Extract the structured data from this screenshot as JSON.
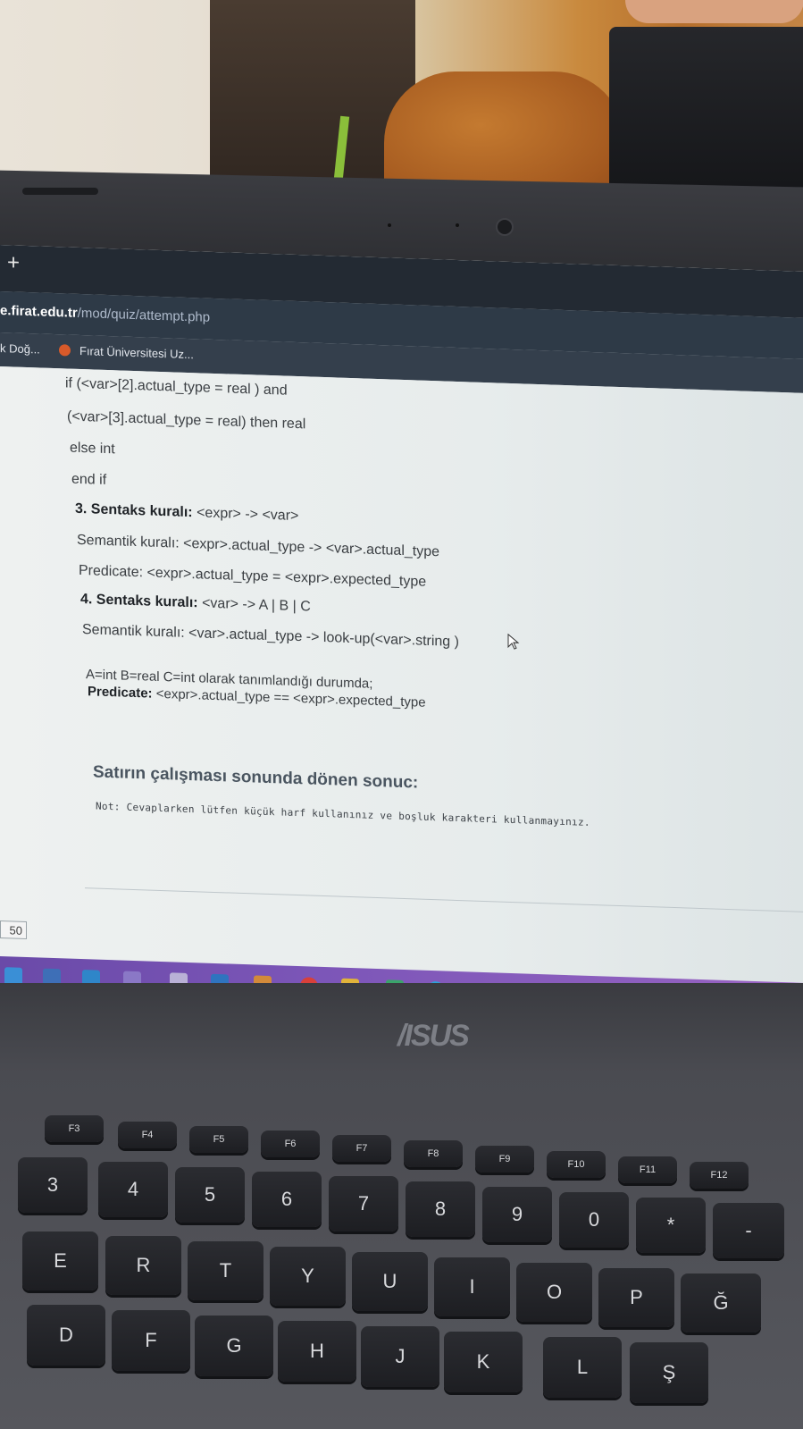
{
  "browser": {
    "new_tab_glyph": "+",
    "url_host": "e.firat.edu.tr",
    "url_path": "/mod/quiz/attempt.php",
    "bookmarks": [
      {
        "label": "k Doğ..."
      },
      {
        "label": "Fırat Üniversitesi Uz..."
      }
    ]
  },
  "quiz": {
    "lines": [
      "if (<var>[2].actual_type = real ) and",
      "(<var>[3].actual_type = real) then real",
      "else int",
      "end if"
    ],
    "rule3_title": "3. Sentaks kuralı:",
    "rule3_syntax": " <expr> -> <var>",
    "rule3_semantic": "Semantik kuralı: <expr>.actual_type -> <var>.actual_type",
    "rule3_predicate": "Predicate: <expr>.actual_type = <expr>.expected_type",
    "rule4_title": "4. Sentaks kuralı:",
    "rule4_syntax": " <var> -> A | B | C",
    "rule4_semantic": "Semantik kuralı: <var>.actual_type -> look-up(<var>.string )",
    "assignment": "A=int B=real C=int olarak tanımlandığı durumda;",
    "predicate_label": "Predicate:",
    "predicate_text": " <expr>.actual_type == <expr>.expected_type",
    "result_heading": "Satırın çalışması sonunda dönen sonuc:",
    "note": "Not: Cevaplarken lütfen küçük harf kullanınız ve boşluk karakteri kullanmayınız.",
    "zoom_fragment": "50"
  },
  "laptop": {
    "brand": "/ISUS"
  },
  "keyboard": {
    "function_row": [
      "F3",
      "F4",
      "F5",
      "F6",
      "F7",
      "F8",
      "F9",
      "F10",
      "F11",
      "F12"
    ],
    "number_row": [
      {
        "main": "3",
        "top": "^",
        "bottom": "#"
      },
      {
        "main": "4",
        "top": "+",
        "bottom": "$"
      },
      {
        "main": "5",
        "top": "%",
        "bottom": "½"
      },
      {
        "main": "6",
        "top": "&",
        "bottom": ""
      },
      {
        "main": "7",
        "top": "/",
        "bottom": "{"
      },
      {
        "main": "8",
        "top": "(",
        "bottom": "["
      },
      {
        "main": "9",
        "top": ")",
        "bottom": "]"
      },
      {
        "main": "0",
        "top": "=",
        "bottom": "}"
      },
      {
        "main": "*",
        "top": "?",
        "bottom": "\\"
      },
      {
        "main": "-",
        "top": "",
        "bottom": ""
      }
    ],
    "letter_row_1": [
      "E",
      "R",
      "T",
      "Y",
      "U",
      "I",
      "O",
      "P",
      "Ğ"
    ],
    "letter_row_1_sub": "€",
    "letter_row_2": [
      "D",
      "F",
      "G",
      "H",
      "J",
      "K",
      "L",
      "Ş"
    ]
  },
  "colors": {
    "taskbar": "#7c56b8",
    "tab_bar": "#232a33",
    "address_bar": "#2e3a47",
    "page_background": "#e9eded"
  }
}
